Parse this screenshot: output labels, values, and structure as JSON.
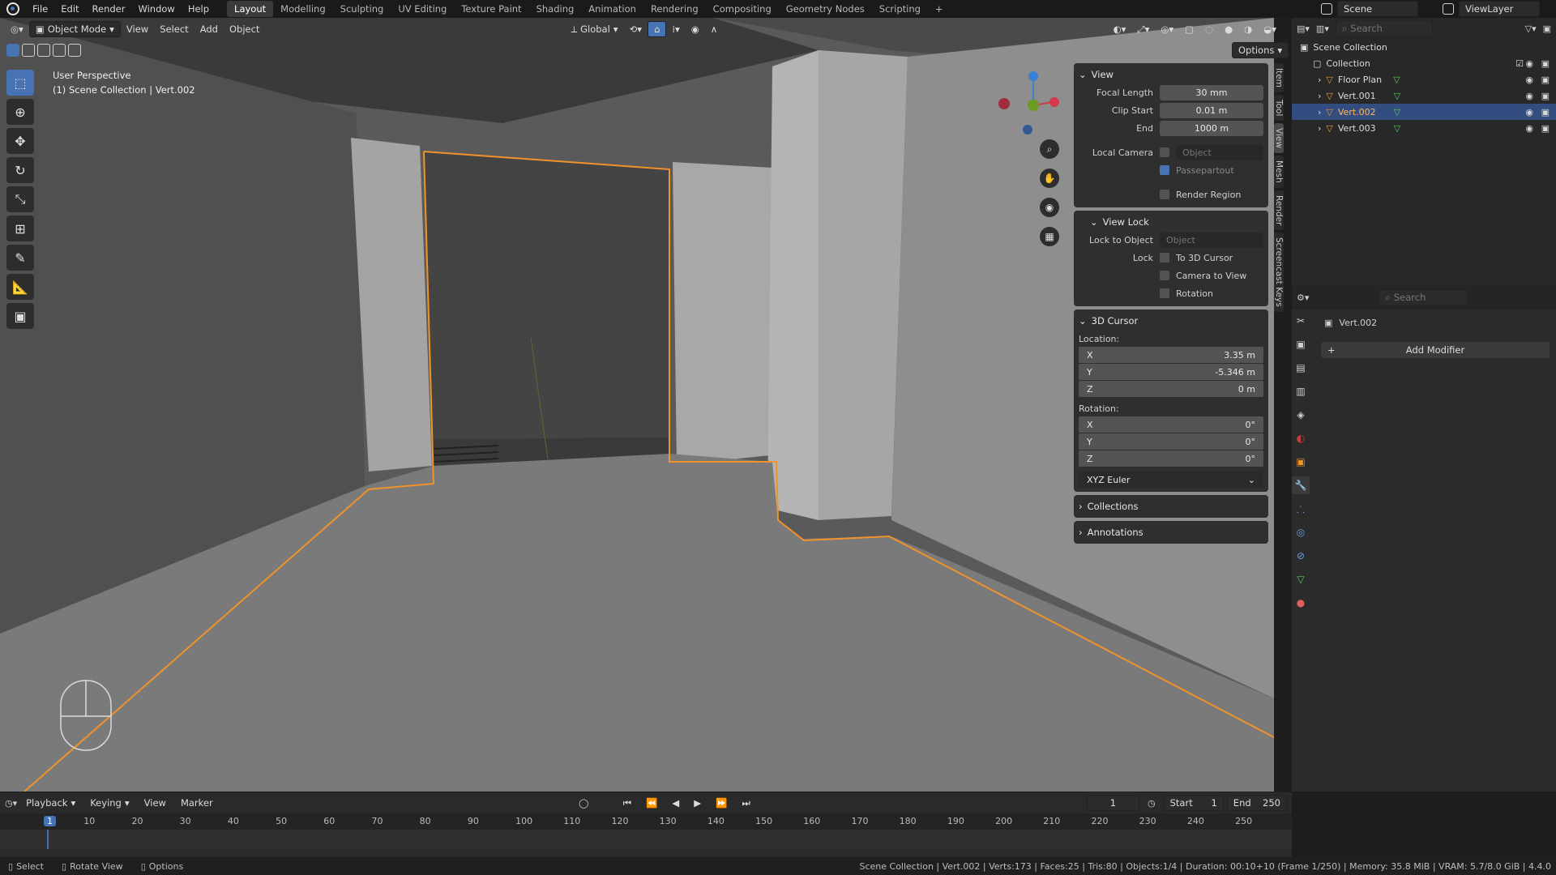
{
  "topbar": {
    "menus": [
      "File",
      "Edit",
      "Render",
      "Window",
      "Help"
    ],
    "workspaces": [
      "Layout",
      "Modelling",
      "Sculpting",
      "UV Editing",
      "Texture Paint",
      "Shading",
      "Animation",
      "Rendering",
      "Compositing",
      "Geometry Nodes",
      "Scripting"
    ],
    "active_workspace": "Layout",
    "scene": "Scene",
    "view_layer": "ViewLayer"
  },
  "viewport": {
    "mode": "Object Mode",
    "menus": [
      "View",
      "Select",
      "Add",
      "Object"
    ],
    "transform_orientation": "Global",
    "options_label": "Options",
    "perspective_label": "User Perspective",
    "collection_label": "(1) Scene Collection | Vert.002"
  },
  "npanel": {
    "view_title": "View",
    "focal_length_label": "Focal Length",
    "focal_length": "30 mm",
    "clip_start_label": "Clip Start",
    "clip_start": "0.01 m",
    "end_label": "End",
    "end": "1000 m",
    "local_camera_label": "Local Camera",
    "object_placeholder": "Object",
    "passepartout": "Passepartout",
    "render_region": "Render Region",
    "view_lock_title": "View Lock",
    "lock_to_object_label": "Lock to Object",
    "lock_label": "Lock",
    "to_3d_cursor": "To 3D Cursor",
    "camera_to_view": "Camera to View",
    "rotation_check": "Rotation",
    "cursor_title": "3D Cursor",
    "location_label": "Location:",
    "loc_x": "3.35 m",
    "loc_y": "-5.346 m",
    "loc_z": "0 m",
    "rotation_label": "Rotation:",
    "rot_x": "0°",
    "rot_y": "0°",
    "rot_z": "0°",
    "euler": "XYZ Euler",
    "collections_title": "Collections",
    "annotations_title": "Annotations",
    "tabs": [
      "Item",
      "Tool",
      "View",
      "Mesh",
      "Render",
      "Screencast Keys"
    ]
  },
  "outliner": {
    "search_placeholder": "Search",
    "root": "Scene Collection",
    "collection": "Collection",
    "items": [
      "Floor Plan",
      "Vert.001",
      "Vert.002",
      "Vert.003"
    ],
    "selected": "Vert.002"
  },
  "properties": {
    "search_placeholder": "Search",
    "object_name": "Vert.002",
    "add_modifier": "Add Modifier"
  },
  "timeline": {
    "menus": [
      "Playback",
      "Keying",
      "View",
      "Marker"
    ],
    "current_frame": "1",
    "start_label": "Start",
    "start": "1",
    "end_label": "End",
    "end": "250",
    "ruler": [
      "1",
      "10",
      "20",
      "30",
      "40",
      "50",
      "60",
      "70",
      "80",
      "90",
      "100",
      "110",
      "120",
      "130",
      "140",
      "150",
      "160",
      "170",
      "180",
      "190",
      "200",
      "210",
      "220",
      "230",
      "240",
      "250"
    ]
  },
  "statusbar": {
    "select": "Select",
    "rotate_view": "Rotate View",
    "options": "Options",
    "stats": "Scene Collection | Vert.002 | Verts:173 | Faces:25 | Tris:80 | Objects:1/4 | Duration: 00:10+10 (Frame 1/250) | Memory: 35.8 MiB | VRAM: 5.7/8.0 GiB | 4.4.0"
  },
  "colors": {
    "accent": "#4772b3",
    "selection_outline": "#f0932a",
    "selected_row": "#334d80"
  }
}
